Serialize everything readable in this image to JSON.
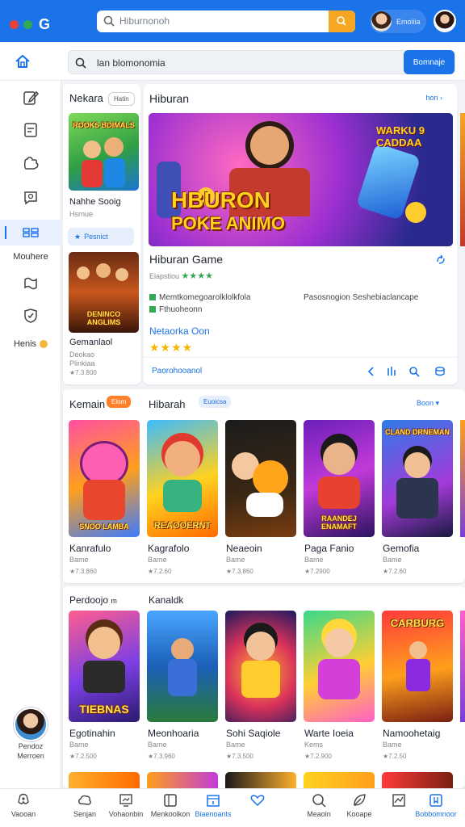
{
  "topbar": {
    "search_placeholder": "Hiburnonoh",
    "user_name": "Emoiiia",
    "colors": {
      "bar": "#1a73e8",
      "dot1": "#ea4335",
      "dot2": "#fbbc05",
      "dot3": "#34a853",
      "search_button": "#f5a623"
    }
  },
  "subheader": {
    "search_value": "lan blomonomia",
    "search_button": "Bomnaje"
  },
  "sidebar": {
    "items": [
      {
        "name": "edit-icon"
      },
      {
        "name": "clipboard-icon"
      },
      {
        "name": "puzzle-icon"
      },
      {
        "name": "chat-icon"
      },
      {
        "name": "grid-icon",
        "active": true
      },
      {
        "label": "Mouhere"
      },
      {
        "name": "map-icon"
      },
      {
        "name": "shield-icon"
      },
      {
        "label": "Henis"
      }
    ],
    "user": {
      "line1": "Pendoz",
      "line2": "Merroen"
    }
  },
  "left_panel": {
    "title": "Nekara",
    "chip": "Hatin",
    "item1": {
      "name": "Nahhe Sooig",
      "sub": "Hsrnue",
      "button": "Pesnict"
    },
    "item2": {
      "name": "Gemanlaol",
      "sub1": "Deokao",
      "sub2": "Plinkiaa",
      "rating": "★7.3.800",
      "cover_title": "DENINCO ANGLIMS"
    },
    "item1_cover_title": "ROOKS BDIMALS"
  },
  "featured": {
    "section_title": "Hiburan",
    "section_link": "hon",
    "banner_title_line1": "HBURON",
    "banner_title_line2": "POKE ANIMO",
    "banner_corner": "WARKU 9 CADDAA",
    "game_title": "Hiburan Game",
    "game_meta": "Eiapstiou",
    "stars": "★★★★",
    "feature1": "Memtkomegoarolklolkfola",
    "feature2": "Fthuoheonn",
    "feature_right": "Pasosnogion Seshebiaclancape",
    "link": "Netaorka Oon",
    "stars2": "★★★★",
    "footer_link": "Paorohooanol"
  },
  "row1": {
    "title": "Kemain",
    "chip": "Elom",
    "title2": "Hibarah",
    "chip2": "Euoicsa",
    "link": "Boon",
    "games": [
      {
        "name": "Kanrafulo",
        "sub": "Bame",
        "rating": "★7.3.860",
        "cover_title": "SNOO LAMBA"
      },
      {
        "name": "Kagrafolo",
        "sub": "Bame",
        "rating": "★7.2.60",
        "cover_title": "REAOOERNT"
      },
      {
        "name": "Neaeoin",
        "sub": "Bame",
        "rating": "★7.3.860",
        "cover_title": ""
      },
      {
        "name": "Paga Fanio",
        "sub": "Bame",
        "rating": "★7.2900",
        "cover_title": "RAANDEJ ENAMAFT"
      },
      {
        "name": "Gemofia",
        "sub": "Bame",
        "rating": "★7.2.60",
        "cover_title": "CLAND DRNEMAN"
      }
    ]
  },
  "row2": {
    "title": "Perdoojo",
    "title_suffix": "m",
    "title2": "Kanaldk",
    "games": [
      {
        "name": "Egotinahin",
        "sub": "Bame",
        "rating": "★7.2.500",
        "cover_title": "TIEBNAS"
      },
      {
        "name": "Meonhoaria",
        "sub": "Bame",
        "rating": "★7.3.960",
        "cover_title": ""
      },
      {
        "name": "Sohi Saqiole",
        "sub": "Bame",
        "rating": "★7.3.500",
        "cover_title": ""
      },
      {
        "name": "Warte Ioeia",
        "sub": "Kems",
        "rating": "★7.2.900",
        "cover_title": ""
      },
      {
        "name": "Namoohetaig",
        "sub": "Bame",
        "rating": "★7.2.50",
        "cover_title": "CARBURG"
      }
    ]
  },
  "bottom_nav": [
    {
      "label": "Vaooan",
      "icon": "joystick-icon"
    },
    {
      "label": "Senjan",
      "icon": "cloud-icon"
    },
    {
      "label": "Vohaonbin",
      "icon": "monitor-icon"
    },
    {
      "label": "Menkoolkon",
      "icon": "tablet-icon"
    },
    {
      "label": "Biaenoants",
      "icon": "calendar-icon",
      "active": true
    },
    {
      "label": "",
      "icon": "heart-icon"
    },
    {
      "label": "Meaoin",
      "icon": "search-icon"
    },
    {
      "label": "Kooape",
      "icon": "leaf-icon"
    },
    {
      "label": "",
      "icon": "chart-icon"
    },
    {
      "label": "Bobbomnoor",
      "icon": "bookmark-icon",
      "active": true
    }
  ]
}
